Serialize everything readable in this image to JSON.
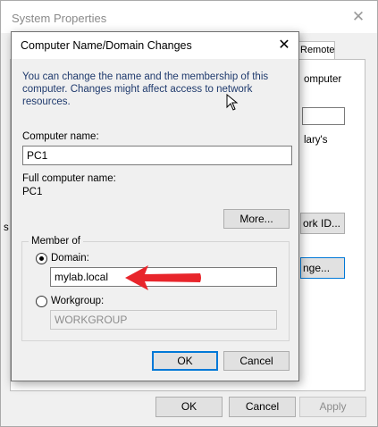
{
  "system_properties": {
    "title": "System Properties",
    "tab_remote": "Remote",
    "peek": {
      "computer_text": "omputer",
      "marys_text": "lary's",
      "network_id_btn": "ork ID...",
      "change_btn": "nge...",
      "side_char": "s"
    },
    "buttons": {
      "ok": "OK",
      "cancel": "Cancel",
      "apply": "Apply"
    }
  },
  "dialog": {
    "title": "Computer Name/Domain Changes",
    "description": "You can change the name and the membership of this computer. Changes might affect access to network resources.",
    "computer_name_label": "Computer name:",
    "computer_name_value": "PC1",
    "full_name_label": "Full computer name:",
    "full_name_value": "PC1",
    "more_button": "More...",
    "member_of": {
      "title": "Member of",
      "domain_label": "Domain:",
      "domain_value": "mylab.local",
      "domain_selected": true,
      "workgroup_label": "Workgroup:",
      "workgroup_value": "WORKGROUP"
    },
    "ok_button": "OK",
    "cancel_button": "Cancel"
  },
  "colors": {
    "annotation_arrow": "#e8252b",
    "focus_border": "#0078d7"
  }
}
